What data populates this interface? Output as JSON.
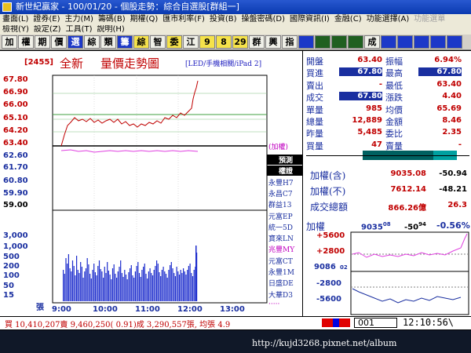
{
  "window": {
    "title": "新世紀贏家 - 100/01/20 - 個股走勢：綜合自選股[群組一]"
  },
  "menu": {
    "row1": [
      "畫面(L)",
      "證券(E)",
      "主力(M)",
      "籌碼(B)",
      "期權(Q)",
      "匯市利率(F)",
      "投資(B)",
      "操盤密碼(D)",
      "國際資訊(I)",
      "金融(C)",
      "功能選擇(A)",
      "功能選單"
    ],
    "row1_disabled": [
      false,
      false,
      false,
      false,
      false,
      false,
      false,
      false,
      false,
      false,
      false,
      true
    ],
    "row2": [
      "檢視(Y)",
      "設定(Z)",
      "工具(T)",
      "說明(H)"
    ]
  },
  "toolbar": [
    "加",
    "權",
    "期",
    "價",
    "選",
    "綜",
    "類",
    "籌",
    "綜",
    "智",
    "委",
    "江",
    "9",
    "8",
    "29",
    "群",
    "興",
    "指",
    "",
    "",
    "",
    "",
    "成",
    "",
    "",
    "",
    "",
    ""
  ],
  "chart": {
    "code": "[2455]",
    "name": "全新",
    "title": "量價走勢圖",
    "subtitle": "[LED/手機相關/iPad 2]",
    "price_ticks": [
      "67.80",
      "66.90",
      "66.00",
      "65.10",
      "64.20",
      "63.40",
      "62.60",
      "61.70",
      "60.80",
      "59.90",
      "59.00"
    ],
    "volume_ticks": [
      "3,000",
      "1,000",
      "500",
      "200",
      "100",
      "50",
      "15",
      "張"
    ],
    "time_ticks": [
      "9:00",
      "10:00",
      "11:00",
      "12:00",
      "13:00"
    ],
    "index_label": "(加權)",
    "ref_price": "63.40",
    "colors": {
      "up": "#c00000",
      "down": "#1a2fa0",
      "index_line": "#e040e0",
      "volume": "#1c2ccc"
    }
  },
  "tickers": [
    {
      "label": "預測",
      "style": "sel"
    },
    {
      "label": "權證",
      "style": "sel"
    },
    {
      "label": "永豐H7",
      "style": ""
    },
    {
      "label": "永昌C7",
      "style": ""
    },
    {
      "label": "群益13",
      "style": ""
    },
    {
      "label": "元富EP",
      "style": ""
    },
    {
      "label": "統一5D",
      "style": ""
    },
    {
      "label": "寶來LN",
      "style": ""
    },
    {
      "label": "兆豐MY",
      "style": "p"
    },
    {
      "label": "元富CT",
      "style": ""
    },
    {
      "label": "永豐1M",
      "style": ""
    },
    {
      "label": "日盛DE",
      "style": ""
    },
    {
      "label": "大華D3",
      "style": ""
    },
    {
      "label": "·····",
      "style": "p"
    }
  ],
  "quote": {
    "rows": [
      {
        "l1": "開盤",
        "v1": "63.40",
        "c1": "red",
        "l2": "振幅",
        "v2": "6.94%",
        "c2": "red"
      },
      {
        "l1": "買進",
        "v1": "67.80",
        "c1": "box",
        "l2": "最高",
        "v2": "67.80",
        "c2": "box"
      },
      {
        "l1": "賣出",
        "v1": "-",
        "c1": "red",
        "l2": "最低",
        "v2": "63.40",
        "c2": "red"
      },
      {
        "l1": "成交",
        "v1": "67.80",
        "c1": "box",
        "l2": "漲跌",
        "v2": "4.40",
        "c2": "red"
      },
      {
        "l1": "單量",
        "v1": "985",
        "c1": "red",
        "l2": "均價",
        "v2": "65.69",
        "c2": "red"
      },
      {
        "l1": "總量",
        "v1": "12,889",
        "c1": "red",
        "l2": "金額",
        "v2": "8.46",
        "c2": "red"
      },
      {
        "l1": "昨量",
        "v1": "5,485",
        "c1": "red",
        "l2": "委比",
        "v2": "2.35",
        "c2": "red"
      },
      {
        "l1": "買量",
        "v1": "47",
        "c1": "red",
        "l2": "賣量",
        "v2": "-",
        "c2": "red"
      }
    ],
    "index_rows": [
      {
        "label": "加權(含)",
        "value": "9035.08",
        "change": "-50.94"
      },
      {
        "label": "加權(不)",
        "value": "7612.14",
        "change": "-48.21"
      },
      {
        "label": "成交總額",
        "value": "866.26億",
        "change": "26.3"
      }
    ],
    "mini": {
      "label": "加權",
      "value": "9035",
      "value_dec": "08",
      "change": "-50",
      "change_dec": "94",
      "pct": "-0.56%",
      "ticks": [
        "+5600",
        "+2800",
        "9086",
        "02",
        "-2800",
        "-5600"
      ]
    }
  },
  "status": {
    "text": "買 10,410,207賣 9,460,250( 0.91)成 3,290,557張, 均張 4.9",
    "code": "001",
    "time": "12:10:56\\"
  },
  "watermark": "http://kujd3268.pixnet.net/album"
}
